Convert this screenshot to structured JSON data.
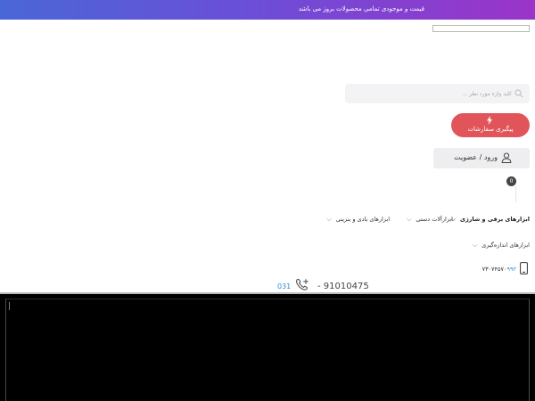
{
  "banner": {
    "text": "قیمت و موجودی تمامی محصولات بروز می باشد"
  },
  "search": {
    "placeholder": "کلید واژه مورد نظر ...",
    "icon": "search-icon"
  },
  "orders": {
    "label": "پیگیری سفارشات",
    "icon": "bolt-icon",
    "color": "#e1555a"
  },
  "login": {
    "label": "ورود / عضویت",
    "icon": "user-icon"
  },
  "cart": {
    "count": "0"
  },
  "nav": {
    "items": [
      {
        "label": "ابزارهای برقی و شارژی"
      },
      {
        "label": "ابزارآلات دستی"
      },
      {
        "label": "ابزارهای بادی و بنزینی"
      },
      {
        "label": "ابزارهای اندازه‌گیری"
      }
    ]
  },
  "contact": {
    "mobile_main": "۷۳۰۷۴۵۷۰",
    "mobile_highlight": "۹۹۲",
    "landline_code": "031",
    "landline_number": "- 91010475"
  },
  "colors": {
    "banner_start": "#4a67d6",
    "banner_end": "#9b34c9",
    "link_blue": "#2b8fd9"
  }
}
